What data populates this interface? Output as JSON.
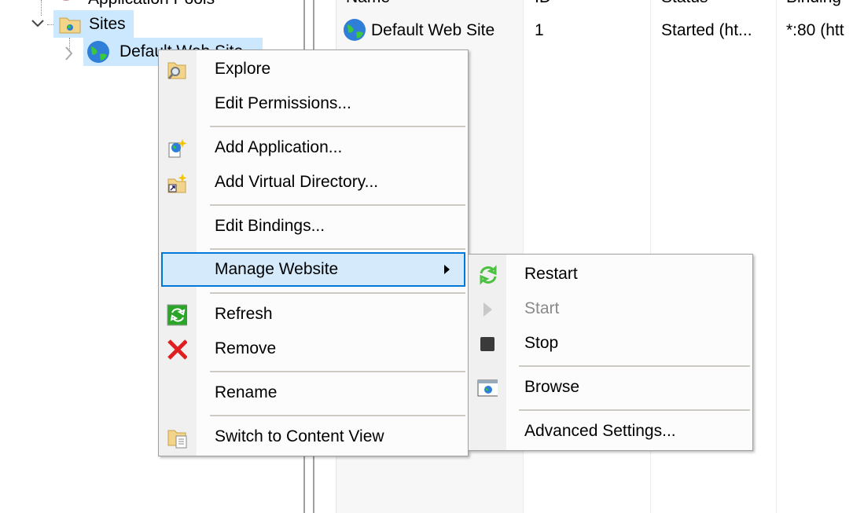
{
  "tree": {
    "application_pools": "Application Pools",
    "sites": "Sites",
    "default_web_site": "Default Web Site"
  },
  "list": {
    "columns": [
      "Name",
      "ID",
      "Status",
      "Binding"
    ],
    "rows": [
      {
        "name": "Default Web Site",
        "id": "1",
        "status": "Started (ht...",
        "binding": "*:80 (htt"
      }
    ]
  },
  "context_menu": {
    "items": [
      {
        "label": "Explore",
        "icon": "folder-search-icon"
      },
      {
        "label": "Edit Permissions...",
        "icon": ""
      },
      {
        "label": "Add Application...",
        "icon": "add-application-icon"
      },
      {
        "label": "Add Virtual Directory...",
        "icon": "add-virtual-directory-icon"
      },
      {
        "label": "Edit Bindings...",
        "icon": ""
      },
      {
        "label": "Manage Website",
        "icon": "",
        "submenu": true,
        "highlighted": true
      },
      {
        "label": "Refresh",
        "icon": "refresh-icon"
      },
      {
        "label": "Remove",
        "icon": "remove-x-icon"
      },
      {
        "label": "Rename",
        "icon": ""
      },
      {
        "label": "Switch to Content View",
        "icon": "content-view-icon"
      }
    ]
  },
  "submenu": {
    "items": [
      {
        "label": "Restart",
        "icon": "restart-icon"
      },
      {
        "label": "Start",
        "icon": "play-icon",
        "disabled": true
      },
      {
        "label": "Stop",
        "icon": "stop-icon"
      },
      {
        "label": "Browse",
        "icon": "browse-icon"
      },
      {
        "label": "Advanced Settings...",
        "icon": ""
      }
    ]
  },
  "colors": {
    "highlight_border": "#0078d7",
    "highlight_bg": "#d5ebfb",
    "selection": "#cce8ff"
  }
}
